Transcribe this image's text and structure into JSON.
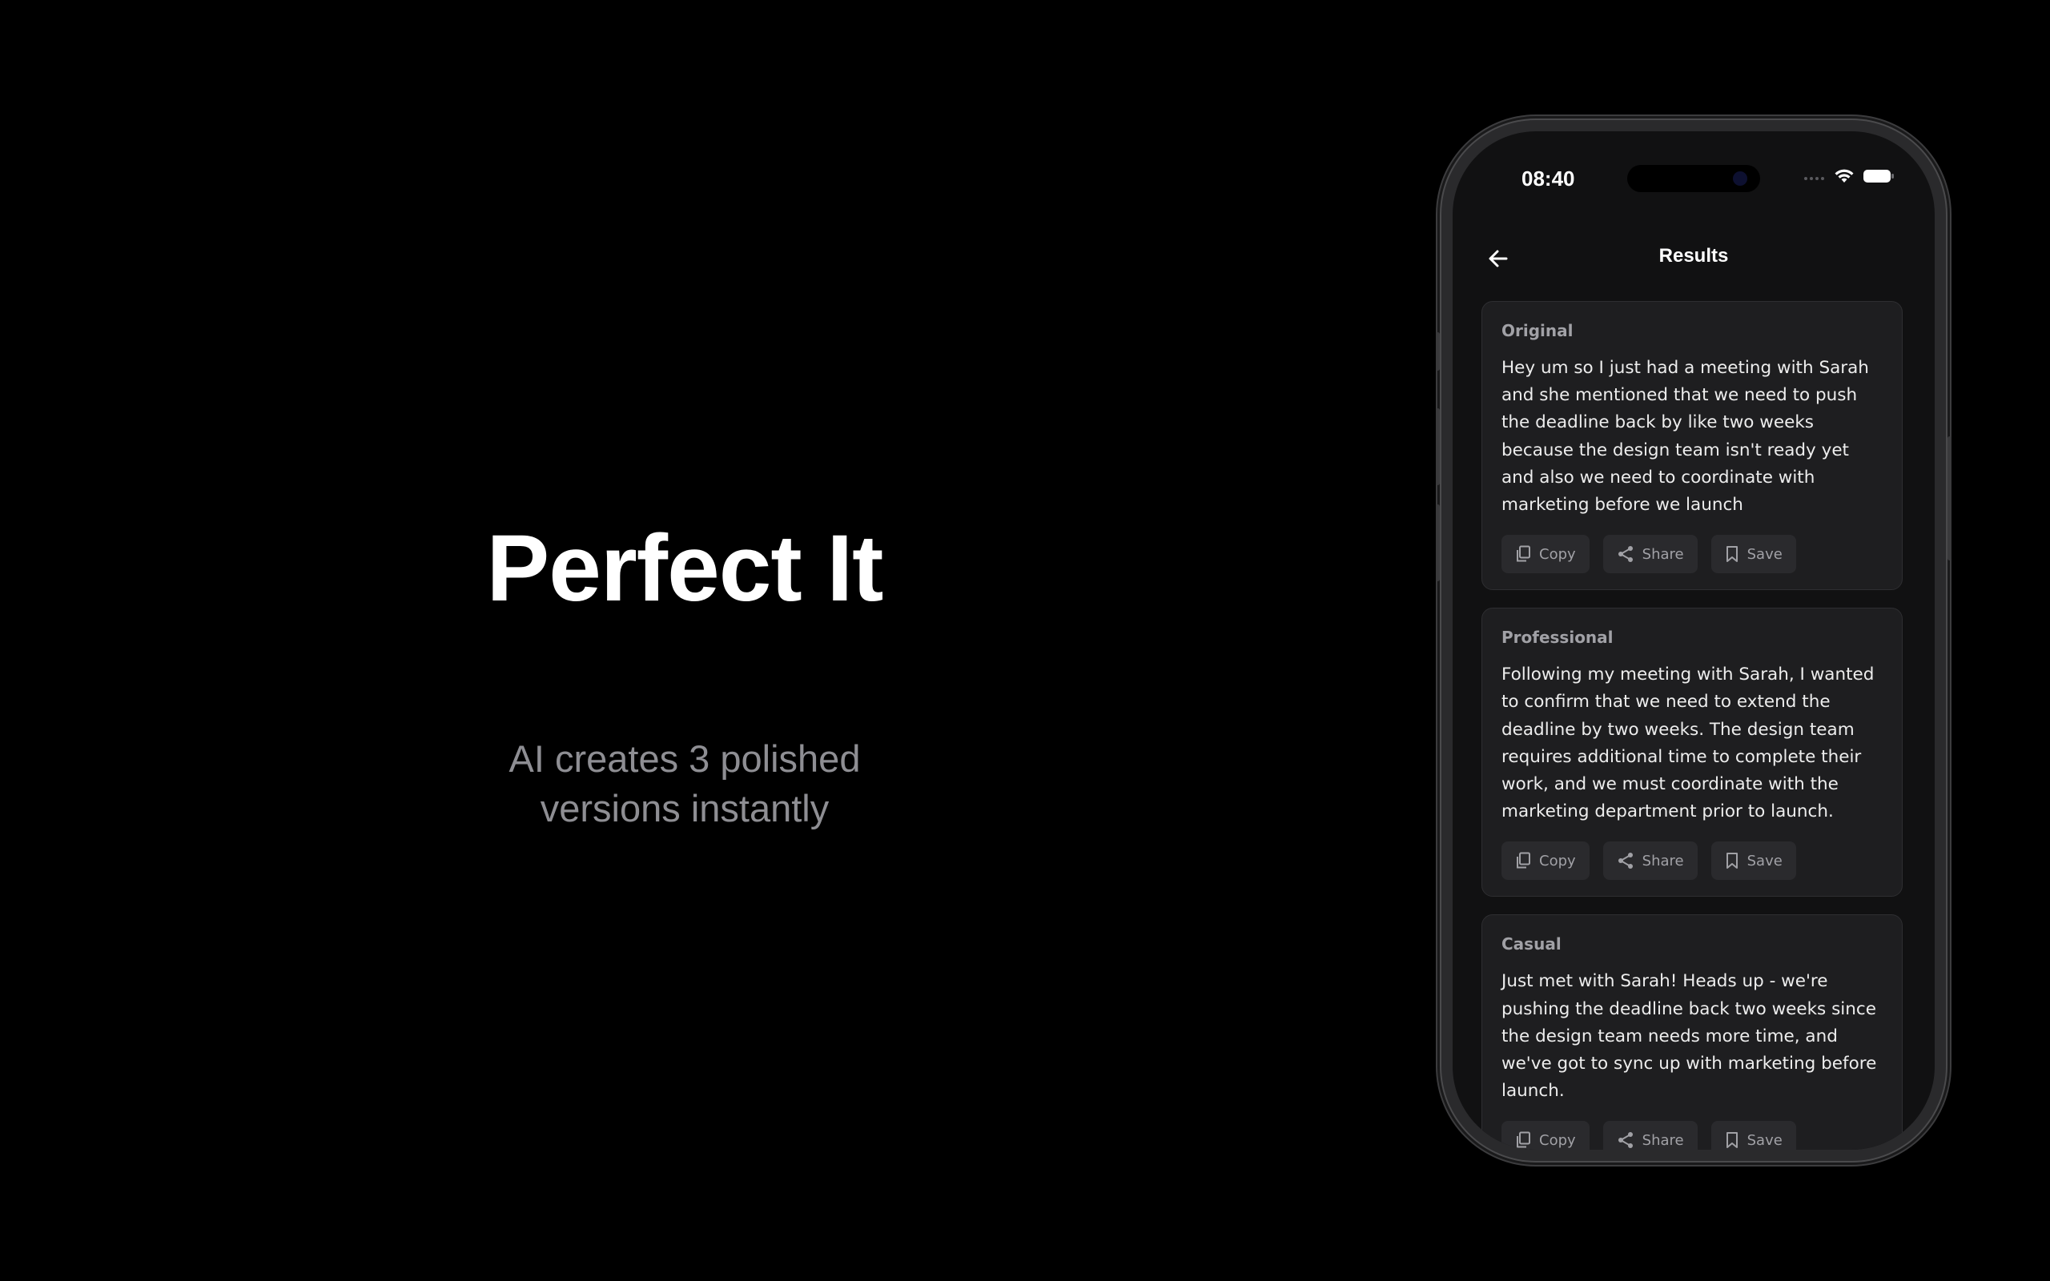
{
  "hero": {
    "headline": "Perfect It",
    "subtitle": "AI creates 3 polished\nversions instantly"
  },
  "status_bar": {
    "time": "08:40",
    "icons": [
      "signal-icon",
      "wifi-icon",
      "battery-icon"
    ]
  },
  "nav": {
    "back_icon": "arrow-left-icon",
    "title": "Results"
  },
  "cards": [
    {
      "label": "Original",
      "text": "Hey um so I just had a meeting with Sarah and she mentioned that we need to push the deadline back by like two weeks because the design team isn't ready yet and also we need to coordinate with marketing before we launch",
      "actions": [
        "Copy",
        "Share",
        "Save"
      ]
    },
    {
      "label": "Professional",
      "text": "Following my meeting with Sarah, I wanted to confirm that we need to extend the deadline by two weeks. The design team requires additional time to complete their work, and we must coordinate with the marketing department prior to launch.",
      "actions": [
        "Copy",
        "Share",
        "Save"
      ]
    },
    {
      "label": "Casual",
      "text": "Just met with Sarah! Heads up - we're pushing the deadline back two weeks since the design team needs more time, and we've got to sync up with marketing before launch.",
      "actions": [
        "Copy",
        "Share",
        "Save"
      ]
    }
  ],
  "colors": {
    "background": "#000000",
    "card": "#1e1e20",
    "button": "#2a2a2d",
    "muted_text": "#a1a1a6"
  }
}
